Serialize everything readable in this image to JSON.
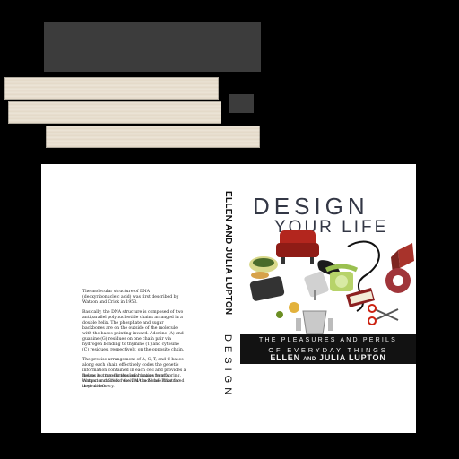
{
  "image": {
    "description_elements": [
      "dark block",
      "stacked book page edges",
      "open book jacket mockup"
    ]
  },
  "book": {
    "back_cover": {
      "paragraphs": [
        "The molecular structure of DNA (deoxyribonucleic acid) was first described by Watson and Crick in 1953.",
        "Basically, the DNA structure is composed of two antiparallel polynucleotide chains arranged in a double helix. The phosphate and sugar backbones are on the outside of the molecule with the bases pointing inward. Adenine (A) and guanine (G) residues on one chain pair via hydrogen bonding to thymine (T) and cytosine (C) residues, respectively, on the opposite chain.",
        "The precise arrangement of A, G, T, and C bases along each chain effectively codes the genetic information contained in each cell and provides a means to transfer this information to offspring. Watson and Crick received the Nobel Prize for their discovery."
      ],
      "footer": "Below is a two-dimensional image from a computer model of the DNA molecule illustrated in your left."
    },
    "spine": {
      "author": "ELLEN AND JULIA LUPTON",
      "title": "DESIGN"
    },
    "front_cover": {
      "title": "DESIGN",
      "subtitle": "YOUR LIFE",
      "tagline_1": "THE PLEASURES AND PERILS",
      "tagline_2": "OF EVERYDAY THINGS",
      "author_first": "ELLEN",
      "author_and": "AND",
      "author_last": "JULIA LUPTON"
    },
    "art_objects": [
      "red-armchair-icon",
      "bowl-icon",
      "food-icon",
      "toaster-icon",
      "mixer-icon",
      "telephone-icon",
      "book-icon",
      "scissors-icon",
      "shoe-icon",
      "box-icon",
      "blender-icon",
      "cord-icon"
    ]
  },
  "colors": {
    "background": "#000000",
    "jacket": "#ffffff",
    "title_ink": "#333745",
    "band": "#121212"
  }
}
